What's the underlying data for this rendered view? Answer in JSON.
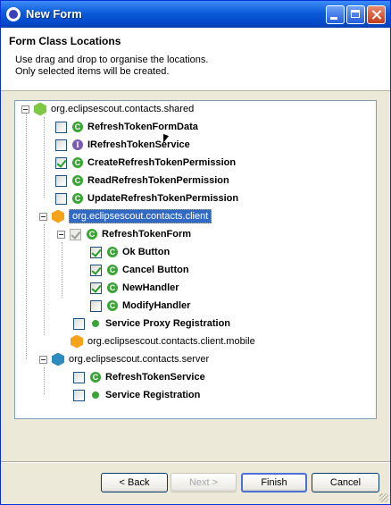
{
  "window": {
    "title": "New Form"
  },
  "header": {
    "title": "Form Class Locations",
    "description_line1": "Use drag and drop to organise the locations.",
    "description_line2": "Only selected items will be created."
  },
  "tree": [
    {
      "label": "org.eclipsescout.contacts.shared",
      "icon": "package-icon",
      "icon_color": "#7ec846",
      "expanded": true,
      "checkbox": false,
      "bold": false
    },
    {
      "label": "RefreshTokenFormData",
      "icon": "class-icon",
      "checkbox": true,
      "checked": false,
      "bold": true
    },
    {
      "label": "IRefreshTokenService",
      "icon": "interface-icon",
      "checkbox": true,
      "checked": false,
      "bold": true
    },
    {
      "label": "CreateRefreshTokenPermission",
      "icon": "class-icon",
      "checkbox": true,
      "checked": true,
      "bold": true
    },
    {
      "label": "ReadRefreshTokenPermission",
      "icon": "class-icon",
      "checkbox": true,
      "checked": false,
      "bold": true
    },
    {
      "label": "UpdateRefreshTokenPermission",
      "icon": "class-icon",
      "checkbox": true,
      "checked": false,
      "bold": true
    },
    {
      "label": "org.eclipsescout.contacts.client",
      "icon": "package-icon",
      "icon_color": "#f4a31b",
      "expanded": true,
      "selected": true,
      "checkbox": false,
      "bold": false
    },
    {
      "label": "RefreshTokenForm",
      "icon": "class-icon",
      "expanded": true,
      "checkbox": true,
      "checked": true,
      "grayed": true,
      "bold": true
    },
    {
      "label": "Ok Button",
      "icon": "class-icon",
      "checkbox": true,
      "checked": true,
      "bold": true
    },
    {
      "label": "Cancel Button",
      "icon": "class-icon",
      "checkbox": true,
      "checked": true,
      "bold": true
    },
    {
      "label": "NewHandler",
      "icon": "class-icon",
      "checkbox": true,
      "checked": true,
      "bold": true
    },
    {
      "label": "ModifyHandler",
      "icon": "class-icon",
      "checkbox": true,
      "checked": false,
      "bold": true
    },
    {
      "label": "Service Proxy Registration",
      "icon": "registration-dot-icon",
      "checkbox": true,
      "checked": false,
      "bold": true
    },
    {
      "label": "org.eclipsescout.contacts.client.mobile",
      "icon": "package-icon",
      "icon_color": "#f4a31b",
      "checkbox": false,
      "bold": false
    },
    {
      "label": "org.eclipsescout.contacts.server",
      "icon": "package-icon",
      "icon_color": "#2e8bc0",
      "expanded": true,
      "checkbox": false,
      "bold": false
    },
    {
      "label": "RefreshTokenService",
      "icon": "class-icon",
      "checkbox": true,
      "checked": false,
      "bold": true
    },
    {
      "label": "Service Registration",
      "icon": "registration-dot-icon",
      "checkbox": true,
      "checked": false,
      "bold": true
    }
  ],
  "buttons": {
    "back": "< Back",
    "next": "Next >",
    "finish": "Finish",
    "cancel": "Cancel"
  }
}
